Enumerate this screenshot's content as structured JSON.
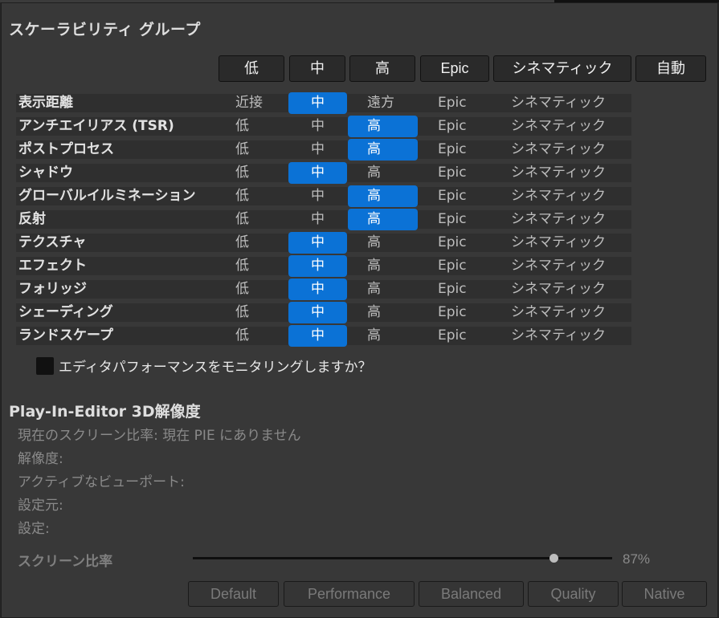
{
  "title": "スケーラビリティ グループ",
  "top_buttons": [
    "低",
    "中",
    "高",
    "Epic",
    "シネマティック",
    "自動"
  ],
  "rows": [
    {
      "label": "表示距離",
      "values": [
        "近接",
        "中",
        "遠方",
        "Epic",
        "シネマティック"
      ],
      "selected": 1
    },
    {
      "label": "アンチエイリアス (TSR)",
      "values": [
        "低",
        "中",
        "高",
        "Epic",
        "シネマティック"
      ],
      "selected": 2
    },
    {
      "label": "ポストプロセス",
      "values": [
        "低",
        "中",
        "高",
        "Epic",
        "シネマティック"
      ],
      "selected": 2
    },
    {
      "label": "シャドウ",
      "values": [
        "低",
        "中",
        "高",
        "Epic",
        "シネマティック"
      ],
      "selected": 1
    },
    {
      "label": "グローバルイルミネーション",
      "values": [
        "低",
        "中",
        "高",
        "Epic",
        "シネマティック"
      ],
      "selected": 2
    },
    {
      "label": "反射",
      "values": [
        "低",
        "中",
        "高",
        "Epic",
        "シネマティック"
      ],
      "selected": 2
    },
    {
      "label": "テクスチャ",
      "values": [
        "低",
        "中",
        "高",
        "Epic",
        "シネマティック"
      ],
      "selected": 1
    },
    {
      "label": "エフェクト",
      "values": [
        "低",
        "中",
        "高",
        "Epic",
        "シネマティック"
      ],
      "selected": 1
    },
    {
      "label": "フォリッジ",
      "values": [
        "低",
        "中",
        "高",
        "Epic",
        "シネマティック"
      ],
      "selected": 1
    },
    {
      "label": "シェーディング",
      "values": [
        "低",
        "中",
        "高",
        "Epic",
        "シネマティック"
      ],
      "selected": 1
    },
    {
      "label": "ランドスケープ",
      "values": [
        "低",
        "中",
        "高",
        "Epic",
        "シネマティック"
      ],
      "selected": 1
    }
  ],
  "monitor_checkbox": {
    "label": "エディタパフォーマンスをモニタリングしますか？",
    "checked": false
  },
  "pie_section": {
    "title": "Play-In-Editor 3D解像度",
    "info_lines": [
      "現在のスクリーン比率: 現在 PIE にありません",
      "解像度:",
      "アクティブなビューポート:",
      "設定元:",
      "設定:"
    ],
    "screen_ratio_label": "スクリーン比率",
    "screen_ratio_value": "87%",
    "screen_ratio_fraction": 0.87,
    "preset_buttons": [
      "Default",
      "Performance",
      "Balanced",
      "Quality",
      "Native"
    ]
  },
  "colors": {
    "accent": "#0b72d6",
    "panel": "#383838",
    "row": "#2f2f2f"
  }
}
